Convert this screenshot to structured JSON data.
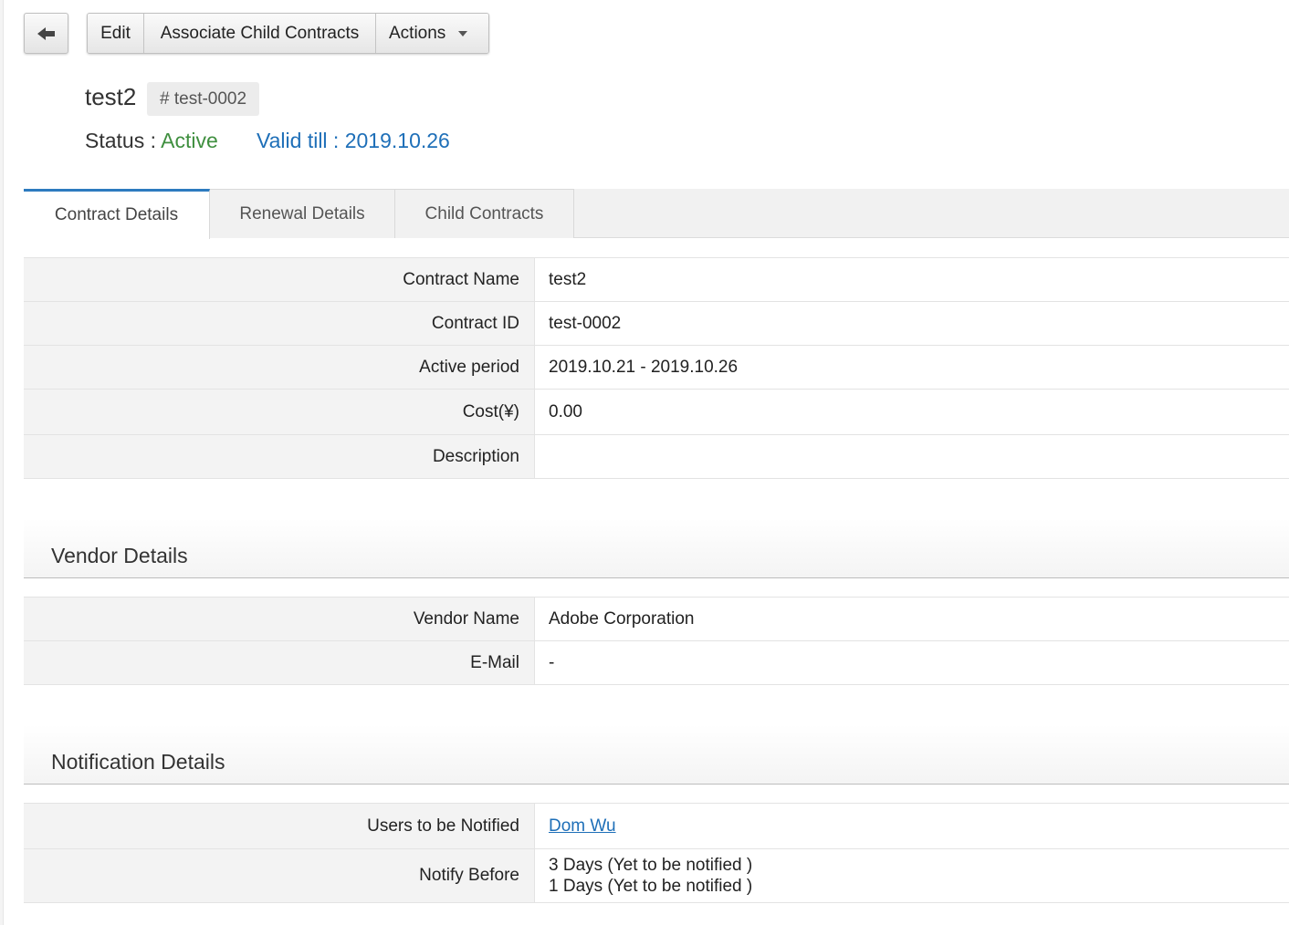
{
  "toolbar": {
    "back_icon": "arrow-left-icon",
    "edit_label": "Edit",
    "associate_label": "Associate Child Contracts",
    "actions_label": "Actions"
  },
  "header": {
    "title": "test2",
    "id_badge": "# test-0002",
    "status_label": "Status : ",
    "status_value": "Active",
    "valid_till": "Valid till : 2019.10.26",
    "status_color": "#3f8f3f",
    "link_color": "#1e6fb8"
  },
  "tabs": [
    {
      "label": "Contract Details",
      "active": true
    },
    {
      "label": "Renewal Details",
      "active": false
    },
    {
      "label": "Child Contracts",
      "active": false
    }
  ],
  "contract_details": {
    "rows": [
      {
        "label": "Contract Name",
        "value": "test2"
      },
      {
        "label": "Contract ID",
        "value": "test-0002"
      },
      {
        "label": "Active period",
        "value": "2019.10.21 - 2019.10.26"
      },
      {
        "label": "Cost(¥)",
        "value": "0.00"
      },
      {
        "label": "Description",
        "value": ""
      }
    ]
  },
  "vendor_details": {
    "heading": "Vendor Details",
    "rows": [
      {
        "label": "Vendor Name",
        "value": "Adobe Corporation"
      },
      {
        "label": "E-Mail",
        "value": "-"
      }
    ]
  },
  "notification_details": {
    "heading": "Notification Details",
    "users_label": "Users to be Notified",
    "users_value": "Dom Wu",
    "notify_label": "Notify Before",
    "notify_lines": [
      "3 Days (Yet to be notified )",
      "1 Days (Yet to be notified )"
    ]
  }
}
